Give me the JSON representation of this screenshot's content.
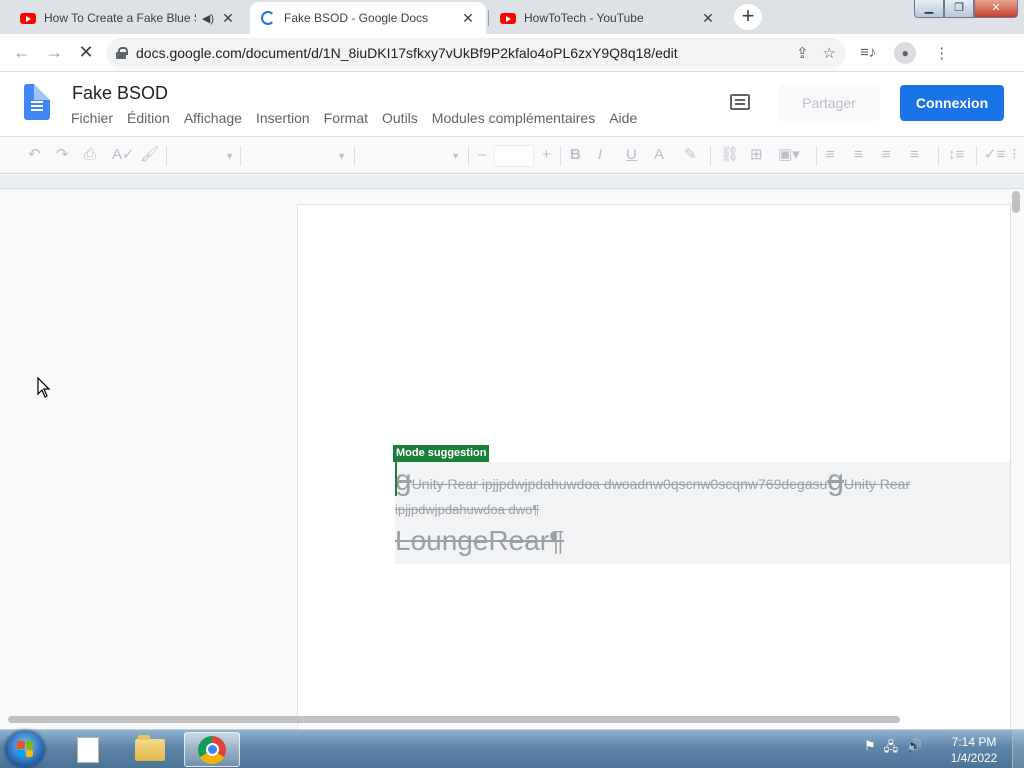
{
  "browser": {
    "tabs": [
      {
        "title": "How To Create a Fake Blue Sc",
        "favicon": "youtube-icon",
        "audio": true,
        "active": false
      },
      {
        "title": "Fake BSOD - Google Docs",
        "favicon": "loading-spinner-icon",
        "audio": false,
        "active": true
      },
      {
        "title": "HowToTech - YouTube",
        "favicon": "youtube-icon",
        "audio": false,
        "active": false
      }
    ],
    "new_tab_label": "+",
    "url": "docs.google.com/document/d/1N_8iuDKI17sfkxy7vUkBf9P2kfalo4oPL6zxY9Q8q18/edit"
  },
  "docs": {
    "title": "Fake BSOD",
    "menu": [
      "Fichier",
      "Édition",
      "Affichage",
      "Insertion",
      "Format",
      "Outils",
      "Modules complémentaires",
      "Aide"
    ],
    "share_label": "Partager",
    "login_label": "Connexion",
    "font_size_minus": "–",
    "font_size_plus": "+"
  },
  "document": {
    "mode_badge": "Mode suggestion",
    "line1": {
      "g1": "g",
      "seg1": "Unity      Rear      ipjjpdwjpdahuwdoa      dwoadnw0qscnw0scqnw769degasu",
      "g2": "g",
      "seg2": "Unity      Rear"
    },
    "line2": "ipjjpdwjpdahuwdoa dwo¶",
    "line3": "LoungeRear¶"
  },
  "taskbar": {
    "time": "7:14 PM",
    "date": "1/4/2022"
  },
  "colors": {
    "accent": "#1a73e8",
    "suggestion_green": "#188038",
    "youtube_red": "#ff0000"
  }
}
